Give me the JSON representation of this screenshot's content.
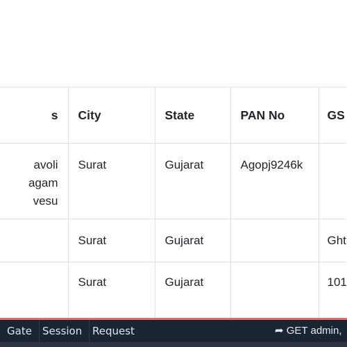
{
  "table": {
    "headers": [
      "s",
      "City",
      "State",
      "PAN No",
      "GS"
    ],
    "rows": [
      {
        "address_lines": [
          "avoli",
          "agam",
          "vesu"
        ],
        "address": "",
        "city": "Surat",
        "state": "Gujarat",
        "pan": "Agopj9246k",
        "gst": ""
      },
      {
        "address": "",
        "city": "Surat",
        "state": "Gujarat",
        "pan": "",
        "gst": "Ght"
      },
      {
        "address": "",
        "city": "Surat",
        "state": "Gujarat",
        "pan": "",
        "gst": "101"
      }
    ]
  },
  "debugbar": {
    "tabs": [
      "Gate",
      "Session",
      "Request"
    ],
    "request_icon": "share-arrow-icon",
    "request_label": "GET admin,",
    "accent": "#e36a6a",
    "background": "#1b2431"
  }
}
